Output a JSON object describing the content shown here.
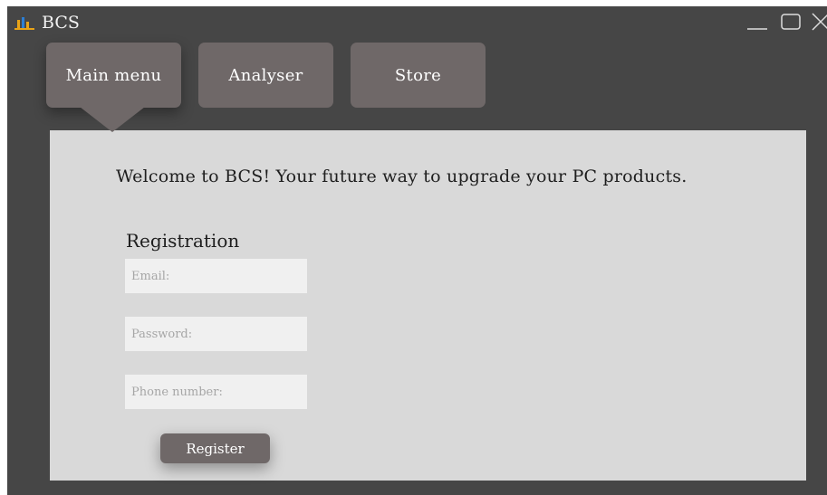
{
  "window": {
    "title": "BCS",
    "icon": "bar-chart-icon",
    "controls": [
      "minimize-icon",
      "maximize-icon",
      "close-icon"
    ]
  },
  "nav": {
    "tabs": [
      {
        "label": "Main menu",
        "active": true
      },
      {
        "label": "Analyser",
        "active": false
      },
      {
        "label": "Store",
        "active": false
      }
    ]
  },
  "main": {
    "welcome_text": "Welcome to BCS! Your future way to upgrade your PC products.",
    "registration": {
      "heading": "Registration",
      "email": {
        "value": "",
        "placeholder": "Email:"
      },
      "password": {
        "value": "",
        "placeholder": "Password:"
      },
      "phone": {
        "value": "",
        "placeholder": "Phone number:"
      },
      "submit_label": "Register"
    }
  },
  "colors": {
    "window_bg": "#464646",
    "tab_bg": "#6f6868",
    "content_bg": "#d9d9d9",
    "field_bg": "#f0f0f0",
    "icon_bars": [
      "#e8a317",
      "#2b7fd6",
      "#e8a317"
    ]
  }
}
